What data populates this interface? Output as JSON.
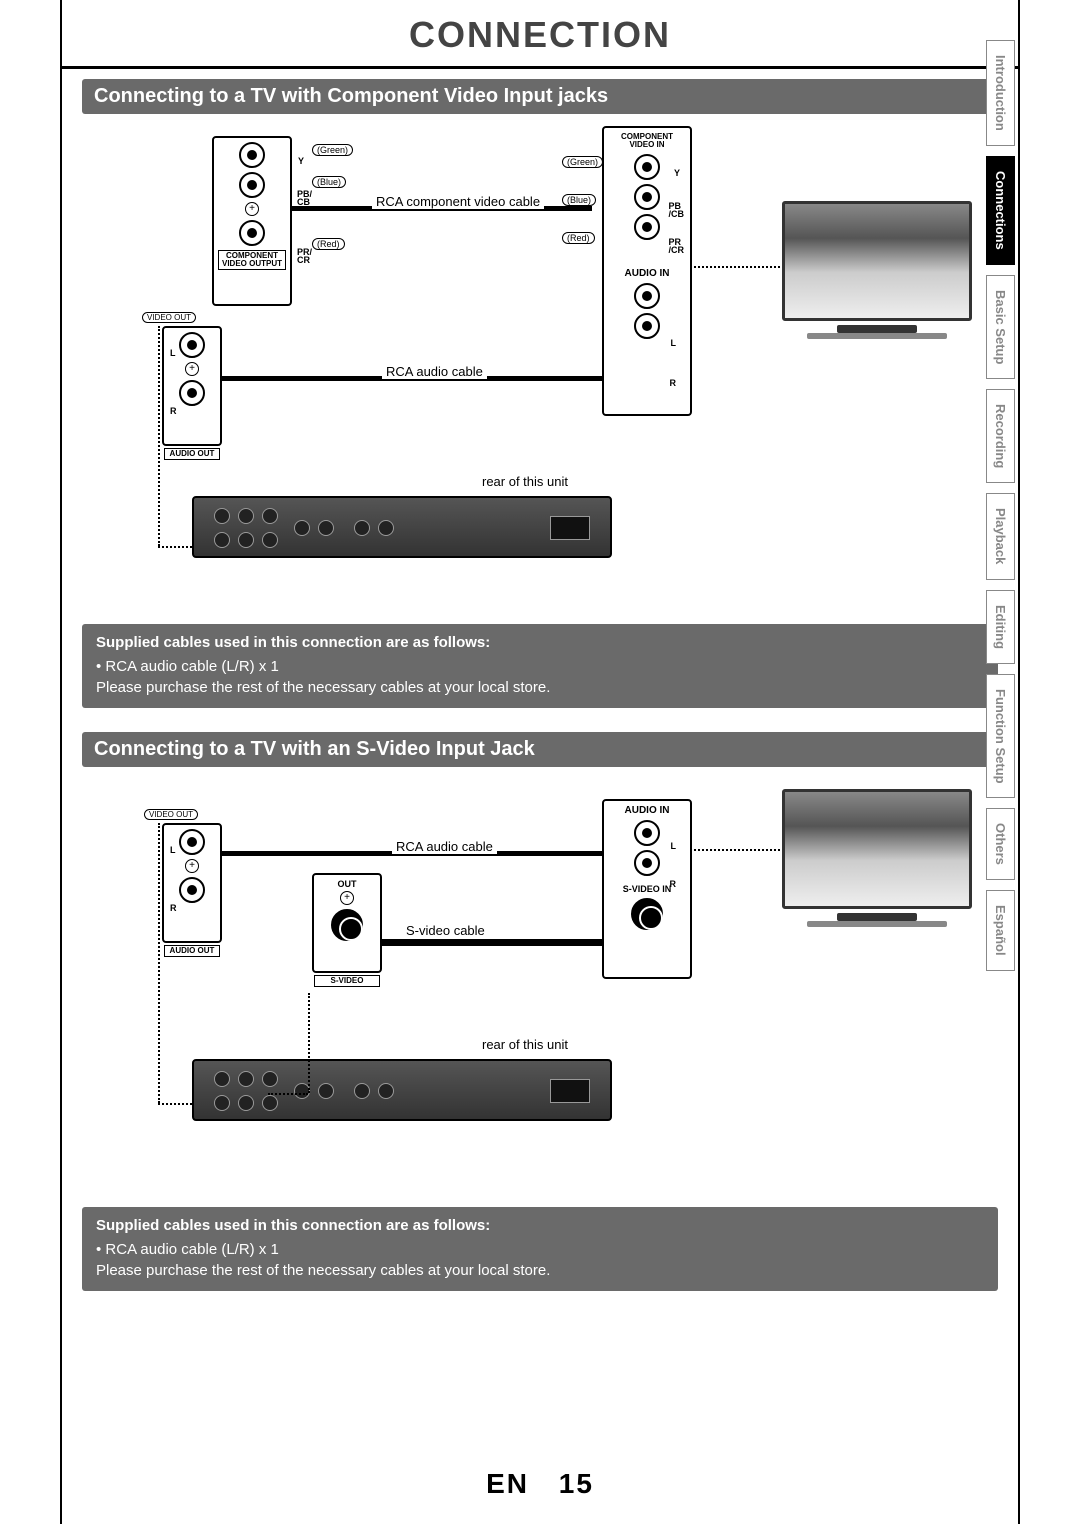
{
  "page_title": "CONNECTION",
  "section1": {
    "title": "Connecting to a TV with Component Video Input jacks",
    "labels": {
      "video_out": "VIDEO OUT",
      "component_output": "COMPONENT\nVIDEO OUTPUT",
      "component_in": "COMPONENT\nVIDEO IN",
      "audio_in": "AUDIO IN",
      "audio_out": "AUDIO OUT",
      "y": "Y",
      "pb_cb_out": "PB/\nCB",
      "pr_cr_out": "PR/\nCR",
      "pb_cb_in": "PB\n/CB",
      "pr_cr_in": "PR\n/CR",
      "l": "L",
      "r": "R",
      "green": "(Green)",
      "blue": "(Blue)",
      "red": "(Red)",
      "cable_video": "RCA component video cable",
      "cable_audio": "RCA audio cable",
      "rear": "rear of this unit"
    },
    "note": {
      "heading": "Supplied cables used in this connection are as follows:",
      "item": "• RCA audio cable (L/R) x 1",
      "extra": "Please purchase the rest of the necessary cables at your local store."
    }
  },
  "section2": {
    "title": "Connecting to a TV with an S-Video Input Jack",
    "labels": {
      "video_out": "VIDEO OUT",
      "audio_in": "AUDIO IN",
      "audio_out": "AUDIO OUT",
      "svideo": "S-VIDEO",
      "svideo_in": "S-VIDEO IN",
      "out": "OUT",
      "l": "L",
      "r": "R",
      "cable_audio": "RCA audio cable",
      "cable_svideo": "S-video cable",
      "rear": "rear of this unit"
    },
    "note": {
      "heading": "Supplied cables used in this connection are as follows:",
      "item": "• RCA audio cable (L/R) x 1",
      "extra": "Please purchase the rest of the necessary cables at your local store."
    }
  },
  "side_tabs": [
    {
      "label": "Introduction",
      "active": false
    },
    {
      "label": "Connections",
      "active": true
    },
    {
      "label": "Basic Setup",
      "active": false
    },
    {
      "label": "Recording",
      "active": false
    },
    {
      "label": "Playback",
      "active": false
    },
    {
      "label": "Editing",
      "active": false
    },
    {
      "label": "Function Setup",
      "active": false
    },
    {
      "label": "Others",
      "active": false
    },
    {
      "label": "Español",
      "active": false
    }
  ],
  "footer": {
    "lang": "EN",
    "page": "15"
  }
}
